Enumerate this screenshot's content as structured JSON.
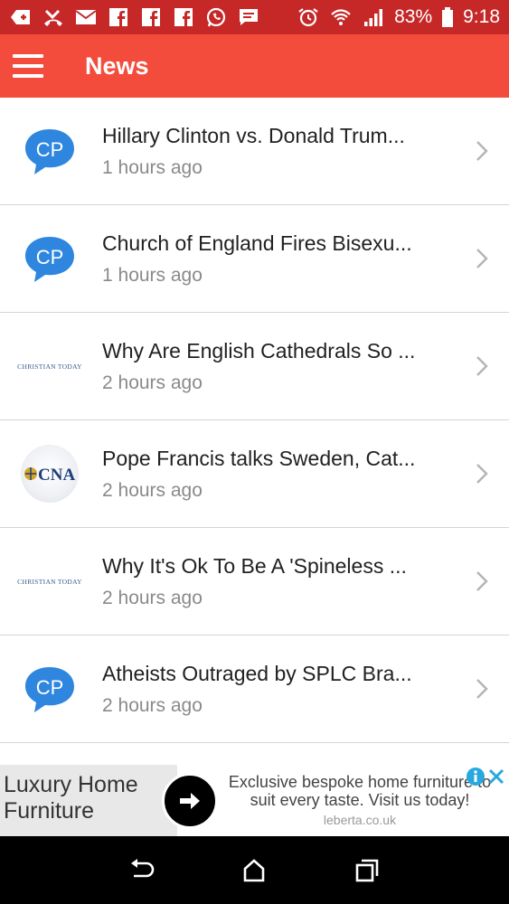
{
  "status_bar": {
    "battery": "83%",
    "time": "9:18"
  },
  "app_bar": {
    "title": "News"
  },
  "news": [
    {
      "headline": "Hillary Clinton vs. Donald Trum...",
      "time": "1 hours ago",
      "source_icon": "cp-logo"
    },
    {
      "headline": "Church of England Fires Bisexu...",
      "time": "1 hours ago",
      "source_icon": "cp-logo"
    },
    {
      "headline": "Why Are English Cathedrals So ...",
      "time": "2 hours ago",
      "source_icon": "christian-today-logo",
      "logo_text": "CHRISTIAN TODAY"
    },
    {
      "headline": "Pope Francis talks Sweden, Cat...",
      "time": "2 hours ago",
      "source_icon": "cna-logo",
      "logo_text": "CNA"
    },
    {
      "headline": "Why It's Ok To Be A 'Spineless ...",
      "time": "2 hours ago",
      "source_icon": "christian-today-logo",
      "logo_text": "CHRISTIAN TODAY"
    },
    {
      "headline": "Atheists Outraged by SPLC Bra...",
      "time": "2 hours ago",
      "source_icon": "cp-logo"
    }
  ],
  "ad": {
    "title": "Luxury Home Furniture",
    "body": "Exclusive bespoke home furniture to suit every taste. Visit us today!",
    "domain": "leberta.co.uk"
  },
  "colors": {
    "status_bar": "#c62828",
    "app_bar": "#f44c3c",
    "cp_blue": "#2e86de"
  }
}
